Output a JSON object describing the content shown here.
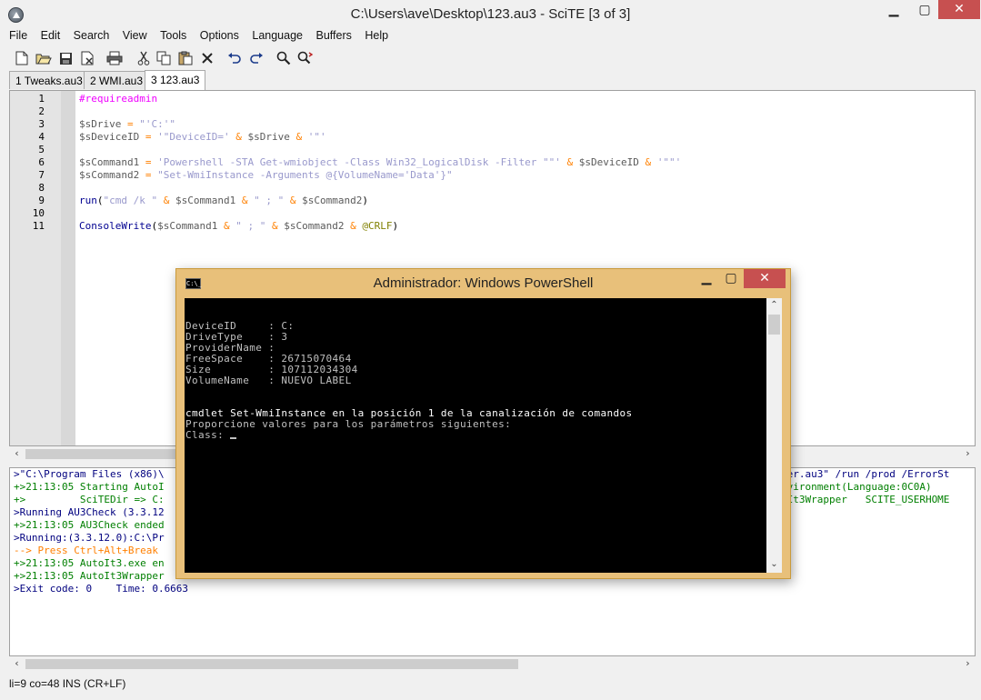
{
  "window": {
    "title": "C:\\Users\\ave\\Desktop\\123.au3 - SciTE [3 of 3]"
  },
  "menu": [
    "File",
    "Edit",
    "Search",
    "View",
    "Tools",
    "Options",
    "Language",
    "Buffers",
    "Help"
  ],
  "tabs": [
    "1 Tweaks.au3",
    "2 WMI.au3",
    "3 123.au3"
  ],
  "active_tab_index": 2,
  "toolbar_icons": [
    "new-file-icon",
    "open-folder-icon",
    "save-icon",
    "close-file-icon",
    "print-icon",
    "cut-icon",
    "copy-icon",
    "paste-icon",
    "delete-icon",
    "undo-icon",
    "redo-icon",
    "find-icon",
    "replace-icon"
  ],
  "editor": {
    "line_numbers": [
      "1",
      "2",
      "3",
      "4",
      "5",
      "6",
      "7",
      "8",
      "9",
      "10",
      "11"
    ],
    "lines": [
      {
        "dir": "#requireadmin"
      },
      {},
      {
        "v1": "$sDrive",
        "o1": " = ",
        "s1": "\"'C:'\""
      },
      {
        "v1": "$sDeviceID",
        "o1": " = ",
        "s1": "'\"DeviceID='",
        "o2": " & ",
        "v2": "$sDrive",
        "o3": " & ",
        "s2": "'\"'"
      },
      {},
      {
        "v1": "$sCommand1",
        "o1": " = ",
        "s1": "'Powershell -STA Get-wmiobject -Class Win32_LogicalDisk -Filter \"\"'",
        "o2": " & ",
        "v2": "$sDeviceID",
        "o3": " & ",
        "s2": "'\"\"'"
      },
      {
        "v1": "$sCommand2",
        "o1": " = ",
        "s1": "\"Set-WmiInstance -Arguments @{VolumeName='Data'}\""
      },
      {},
      {
        "fn": "run",
        "p1": "(",
        "s1": "\"cmd /k \"",
        "o1": " & ",
        "v1": "$sCommand1",
        "o2": " & ",
        "s2": "\" ; \"",
        "o3": " & ",
        "v2": "$sCommand2",
        "p2": ")"
      },
      {},
      {
        "fn": "ConsoleWrite",
        "p1": "(",
        "v1": "$sCommand1",
        "o1": " & ",
        "s1": "\" ; \"",
        "o2": " & ",
        "v2": "$sCommand2",
        "o3": " & ",
        "m1": "@CRLF",
        "p2": ")"
      }
    ]
  },
  "output": {
    "colors": {
      "blue": "#00007f",
      "green": "#007f00",
      "orange": "#ff7f00"
    },
    "lines": [
      {
        "color": "blue",
        "left": ">\"C:\\Program Files (x86)\\",
        "right": "per.au3\" /run /prod /ErrorSt"
      },
      {
        "color": "green",
        "left": "+>21:13:05 Starting AutoI",
        "right": "nvironment(Language:0C0A)"
      },
      {
        "color": "green",
        "left": "+>         SciTEDir => C:",
        "right": "oIt3Wrapper   SCITE_USERHOME"
      },
      {
        "color": "blue",
        "left": ">Running AU3Check (3.3.12",
        "right": ""
      },
      {
        "color": "green",
        "left": "+>21:13:05 AU3Check ended",
        "right": ""
      },
      {
        "color": "blue",
        "left": ">Running:(3.3.12.0):C:\\Pr",
        "right": ""
      },
      {
        "color": "orange",
        "left": "--> Press Ctrl+Alt+Break",
        "right": ""
      },
      {
        "color": "green",
        "left": "+>21:13:05 AutoIt3.exe en",
        "right": ""
      },
      {
        "color": "green",
        "left": "+>21:13:05 AutoIt3Wrapper",
        "right": ""
      },
      {
        "color": "blue",
        "left": ">Exit code: 0    Time: 0.6663",
        "right": ""
      }
    ]
  },
  "status": "li=9 co=48 INS (CR+LF)",
  "powershell": {
    "title": "Administrador: Windows PowerShell",
    "icon_text": "C:\\_",
    "lines": [
      "",
      "DeviceID     : C:",
      "DriveType    : 3",
      "ProviderName :",
      "FreeSpace    : 26715070464",
      "Size         : 107112034304",
      "VolumeName   : NUEVO LABEL",
      "",
      "",
      "cmdlet Set-WmiInstance en la posición 1 de la canalización de comandos",
      "Proporcione valores para los parámetros siguientes:",
      "Class: "
    ]
  }
}
